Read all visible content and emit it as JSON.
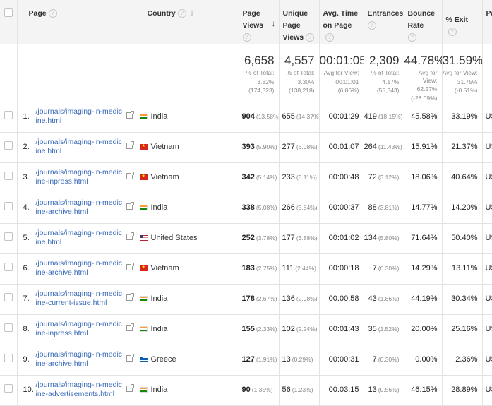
{
  "columns": {
    "page": "Page",
    "country": "Country",
    "page_views": "Page Views",
    "unique_page_views": "Unique Page Views",
    "avg_time": "Avg. Time on Page",
    "entrances": "Entrances",
    "bounce_rate": "Bounce Rate",
    "exit": "% Exit",
    "next": "Pag"
  },
  "help_glyph": "?",
  "totals": {
    "page_views": {
      "value": "6,658",
      "line1": "% of Total:",
      "line2": "3.82%",
      "line3": "(174,323)"
    },
    "unique_page_views": {
      "value": "4,557",
      "line1": "% of Total:",
      "line2": "3.30%",
      "line3": "(138,218)"
    },
    "avg_time": {
      "value": "00:01:05",
      "line1": "Avg for View:",
      "line2": "00:01:01",
      "line3": "(6.86%)"
    },
    "entrances": {
      "value": "2,309",
      "line1": "% of Total:",
      "line2": "4.17%",
      "line3": "(55,343)"
    },
    "bounce_rate": {
      "value": "44.78%",
      "line1": "Avg for View:",
      "line2": "62.27%",
      "line3": "(-28.09%)"
    },
    "exit": {
      "value": "31.59%",
      "line1": "Avg for View:",
      "line2": "31.75%",
      "line3": "(-0.51%)"
    }
  },
  "rows": [
    {
      "num": "1.",
      "page": "/journals/imaging-in-medicine.html",
      "flag": "in",
      "country": "India",
      "pv": "904",
      "pv_pct": "(13.58%)",
      "upv": "655",
      "upv_pct": "(14.37%)",
      "time": "00:01:29",
      "ent": "419",
      "ent_pct": "(18.15%)",
      "bounce": "45.58%",
      "exit": "33.19%",
      "next": "US"
    },
    {
      "num": "2.",
      "page": "/journals/imaging-in-medicine.html",
      "flag": "vn",
      "country": "Vietnam",
      "pv": "393",
      "pv_pct": "(5.90%)",
      "upv": "277",
      "upv_pct": "(6.08%)",
      "time": "00:01:07",
      "ent": "264",
      "ent_pct": "(11.43%)",
      "bounce": "15.91%",
      "exit": "21.37%",
      "next": "US"
    },
    {
      "num": "3.",
      "page": "/journals/imaging-in-medicine-inpress.html",
      "flag": "vn",
      "country": "Vietnam",
      "pv": "342",
      "pv_pct": "(5.14%)",
      "upv": "233",
      "upv_pct": "(5.11%)",
      "time": "00:00:48",
      "ent": "72",
      "ent_pct": "(3.12%)",
      "bounce": "18.06%",
      "exit": "40.64%",
      "next": "US"
    },
    {
      "num": "4.",
      "page": "/journals/imaging-in-medicine-archive.html",
      "flag": "in",
      "country": "India",
      "pv": "338",
      "pv_pct": "(5.08%)",
      "upv": "266",
      "upv_pct": "(5.84%)",
      "time": "00:00:37",
      "ent": "88",
      "ent_pct": "(3.81%)",
      "bounce": "14.77%",
      "exit": "14.20%",
      "next": "US"
    },
    {
      "num": "5.",
      "page": "/journals/imaging-in-medicine.html",
      "flag": "us",
      "country": "United States",
      "pv": "252",
      "pv_pct": "(3.78%)",
      "upv": "177",
      "upv_pct": "(3.88%)",
      "time": "00:01:02",
      "ent": "134",
      "ent_pct": "(5.80%)",
      "bounce": "71.64%",
      "exit": "50.40%",
      "next": "US"
    },
    {
      "num": "6.",
      "page": "/journals/imaging-in-medicine-archive.html",
      "flag": "vn",
      "country": "Vietnam",
      "pv": "183",
      "pv_pct": "(2.75%)",
      "upv": "111",
      "upv_pct": "(2.44%)",
      "time": "00:00:18",
      "ent": "7",
      "ent_pct": "(0.30%)",
      "bounce": "14.29%",
      "exit": "13.11%",
      "next": "US"
    },
    {
      "num": "7.",
      "page": "/journals/imaging-in-medicine-current-issue.html",
      "flag": "in",
      "country": "India",
      "pv": "178",
      "pv_pct": "(2.67%)",
      "upv": "136",
      "upv_pct": "(2.98%)",
      "time": "00:00:58",
      "ent": "43",
      "ent_pct": "(1.86%)",
      "bounce": "44.19%",
      "exit": "30.34%",
      "next": "US"
    },
    {
      "num": "8.",
      "page": "/journals/imaging-in-medicine-inpress.html",
      "flag": "in",
      "country": "India",
      "pv": "155",
      "pv_pct": "(2.33%)",
      "upv": "102",
      "upv_pct": "(2.24%)",
      "time": "00:01:43",
      "ent": "35",
      "ent_pct": "(1.52%)",
      "bounce": "20.00%",
      "exit": "25.16%",
      "next": "US"
    },
    {
      "num": "9.",
      "page": "/journals/imaging-in-medicine-archive.html",
      "flag": "gr",
      "country": "Greece",
      "pv": "127",
      "pv_pct": "(1.91%)",
      "upv": "13",
      "upv_pct": "(0.29%)",
      "time": "00:00:31",
      "ent": "7",
      "ent_pct": "(0.30%)",
      "bounce": "0.00%",
      "exit": "2.36%",
      "next": "US"
    },
    {
      "num": "10.",
      "page": "/journals/imaging-in-medicine-advertisements.html",
      "flag": "in",
      "country": "India",
      "pv": "90",
      "pv_pct": "(1.35%)",
      "upv": "56",
      "upv_pct": "(1.23%)",
      "time": "00:03:15",
      "ent": "13",
      "ent_pct": "(0.56%)",
      "bounce": "46.15%",
      "exit": "28.89%",
      "next": "US"
    }
  ]
}
